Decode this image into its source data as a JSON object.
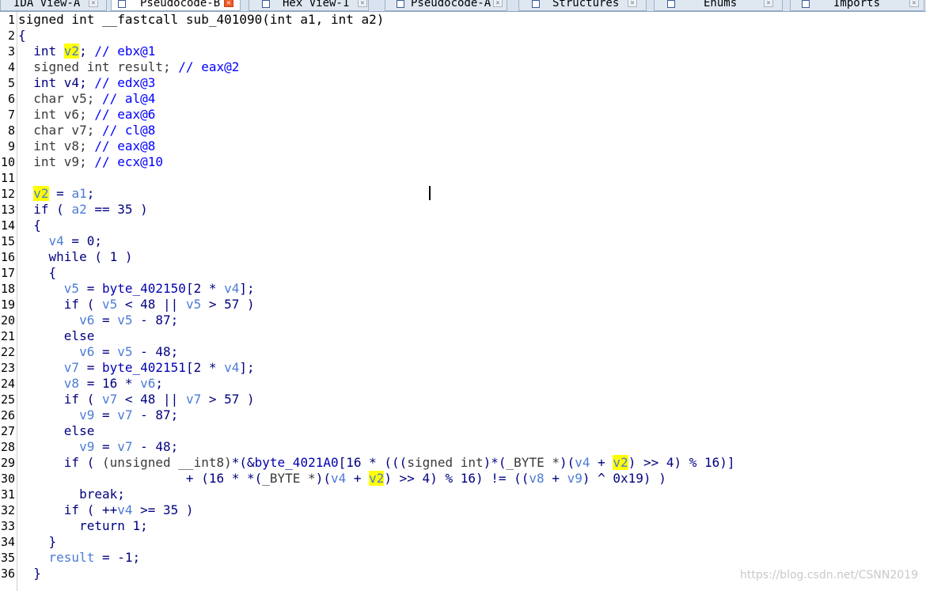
{
  "tabs": [
    {
      "label": "IDA View-A",
      "active": false,
      "icon": "ida-view-icon"
    },
    {
      "label": "Pseudocode-B",
      "active": true,
      "icon": "pseudocode-icon"
    },
    {
      "label": "Hex View-1",
      "active": false,
      "icon": "hex-view-icon"
    },
    {
      "label": "Pseudocode-A",
      "active": false,
      "icon": "pseudocode-icon"
    },
    {
      "label": "Structures",
      "active": false,
      "icon": "structures-icon"
    },
    {
      "label": "Enums",
      "active": false,
      "icon": "enums-icon"
    },
    {
      "label": "Imports",
      "active": false,
      "icon": "imports-icon"
    }
  ],
  "code": {
    "highlight_variable": "v2",
    "lines": [
      {
        "n": "1",
        "tokens": [
          [
            "plain",
            "signed int __fastcall sub_401090(int a1, int a2)"
          ]
        ]
      },
      {
        "n": "2",
        "tokens": [
          [
            "txt",
            "{"
          ]
        ]
      },
      {
        "n": "3",
        "tokens": [
          [
            "txt",
            "  int "
          ],
          [
            "varhl",
            "v2"
          ],
          [
            "txt",
            "; "
          ],
          [
            "cm",
            "// ebx@1"
          ]
        ]
      },
      {
        "n": "4",
        "tokens": [
          [
            "cast",
            "  signed int result; "
          ],
          [
            "cm",
            "// eax@2"
          ]
        ]
      },
      {
        "n": "5",
        "tokens": [
          [
            "txt",
            "  int v4; "
          ],
          [
            "cm",
            "// edx@3"
          ]
        ]
      },
      {
        "n": "6",
        "tokens": [
          [
            "cast",
            "  char v5; "
          ],
          [
            "cm",
            "// al@4"
          ]
        ]
      },
      {
        "n": "7",
        "tokens": [
          [
            "cast",
            "  int v6; "
          ],
          [
            "cm",
            "// eax@6"
          ]
        ]
      },
      {
        "n": "8",
        "tokens": [
          [
            "cast",
            "  char v7; "
          ],
          [
            "cm",
            "// cl@8"
          ]
        ]
      },
      {
        "n": "9",
        "tokens": [
          [
            "cast",
            "  int v8; "
          ],
          [
            "cm",
            "// eax@8"
          ]
        ]
      },
      {
        "n": "10",
        "tokens": [
          [
            "cast",
            "  int v9; "
          ],
          [
            "cm",
            "// ecx@10"
          ]
        ]
      },
      {
        "n": "11",
        "tokens": []
      },
      {
        "n": "12",
        "tokens": [
          [
            "txt",
            "  "
          ],
          [
            "varhl",
            "v2"
          ],
          [
            "txt",
            " = "
          ],
          [
            "var",
            "a1"
          ],
          [
            "txt",
            ";"
          ]
        ]
      },
      {
        "n": "13",
        "tokens": [
          [
            "txt",
            "  if ( "
          ],
          [
            "var",
            "a2"
          ],
          [
            "txt",
            " == 35 )"
          ]
        ]
      },
      {
        "n": "14",
        "tokens": [
          [
            "txt",
            "  {"
          ]
        ]
      },
      {
        "n": "15",
        "tokens": [
          [
            "txt",
            "    "
          ],
          [
            "var",
            "v4"
          ],
          [
            "txt",
            " = 0;"
          ]
        ]
      },
      {
        "n": "16",
        "tokens": [
          [
            "txt",
            "    while ( 1 )"
          ]
        ]
      },
      {
        "n": "17",
        "tokens": [
          [
            "txt",
            "    {"
          ]
        ]
      },
      {
        "n": "18",
        "tokens": [
          [
            "txt",
            "      "
          ],
          [
            "var",
            "v5"
          ],
          [
            "txt",
            " = "
          ],
          [
            "glob",
            "byte_402150"
          ],
          [
            "txt",
            "[2 * "
          ],
          [
            "var",
            "v4"
          ],
          [
            "txt",
            "];"
          ]
        ]
      },
      {
        "n": "19",
        "tokens": [
          [
            "txt",
            "      if ( "
          ],
          [
            "var",
            "v5"
          ],
          [
            "txt",
            " < 48 || "
          ],
          [
            "var",
            "v5"
          ],
          [
            "txt",
            " > 57 )"
          ]
        ]
      },
      {
        "n": "20",
        "tokens": [
          [
            "txt",
            "        "
          ],
          [
            "var",
            "v6"
          ],
          [
            "txt",
            " = "
          ],
          [
            "var",
            "v5"
          ],
          [
            "txt",
            " - 87;"
          ]
        ]
      },
      {
        "n": "21",
        "tokens": [
          [
            "txt",
            "      else"
          ]
        ]
      },
      {
        "n": "22",
        "tokens": [
          [
            "txt",
            "        "
          ],
          [
            "var",
            "v6"
          ],
          [
            "txt",
            " = "
          ],
          [
            "var",
            "v5"
          ],
          [
            "txt",
            " - 48;"
          ]
        ]
      },
      {
        "n": "23",
        "tokens": [
          [
            "txt",
            "      "
          ],
          [
            "var",
            "v7"
          ],
          [
            "txt",
            " = "
          ],
          [
            "glob",
            "byte_402151"
          ],
          [
            "txt",
            "[2 * "
          ],
          [
            "var",
            "v4"
          ],
          [
            "txt",
            "];"
          ]
        ]
      },
      {
        "n": "24",
        "tokens": [
          [
            "txt",
            "      "
          ],
          [
            "var",
            "v8"
          ],
          [
            "txt",
            " = 16 * "
          ],
          [
            "var",
            "v6"
          ],
          [
            "txt",
            ";"
          ]
        ]
      },
      {
        "n": "25",
        "tokens": [
          [
            "txt",
            "      if ( "
          ],
          [
            "var",
            "v7"
          ],
          [
            "txt",
            " < 48 || "
          ],
          [
            "var",
            "v7"
          ],
          [
            "txt",
            " > 57 )"
          ]
        ]
      },
      {
        "n": "26",
        "tokens": [
          [
            "txt",
            "        "
          ],
          [
            "var",
            "v9"
          ],
          [
            "txt",
            " = "
          ],
          [
            "var",
            "v7"
          ],
          [
            "txt",
            " - 87;"
          ]
        ]
      },
      {
        "n": "27",
        "tokens": [
          [
            "txt",
            "      else"
          ]
        ]
      },
      {
        "n": "28",
        "tokens": [
          [
            "txt",
            "        "
          ],
          [
            "var",
            "v9"
          ],
          [
            "txt",
            " = "
          ],
          [
            "var",
            "v7"
          ],
          [
            "txt",
            " - 48;"
          ]
        ]
      },
      {
        "n": "29",
        "tokens": [
          [
            "txt",
            "      if ( "
          ],
          [
            "cast",
            "(unsigned __int8)"
          ],
          [
            "txt",
            "*(&"
          ],
          [
            "glob",
            "byte_4021A0"
          ],
          [
            "txt",
            "[16 * ((("
          ],
          [
            "cast",
            "signed int"
          ],
          [
            "txt",
            ")*("
          ],
          [
            "cast",
            "_BYTE *"
          ],
          [
            "txt",
            ")("
          ],
          [
            "var",
            "v4"
          ],
          [
            "txt",
            " + "
          ],
          [
            "varhl",
            "v2"
          ],
          [
            "txt",
            ") >> 4) % 16)]"
          ]
        ]
      },
      {
        "n": "30",
        "tokens": [
          [
            "txt",
            "                      + (16 * *("
          ],
          [
            "cast",
            "_BYTE *"
          ],
          [
            "txt",
            ")("
          ],
          [
            "var",
            "v4"
          ],
          [
            "txt",
            " + "
          ],
          [
            "varhl",
            "v2"
          ],
          [
            "txt",
            ") >> 4) % 16) != (("
          ],
          [
            "var",
            "v8"
          ],
          [
            "txt",
            " + "
          ],
          [
            "var",
            "v9"
          ],
          [
            "txt",
            ") ^ 0x19) )"
          ]
        ]
      },
      {
        "n": "31",
        "tokens": [
          [
            "txt",
            "        break;"
          ]
        ]
      },
      {
        "n": "32",
        "tokens": [
          [
            "txt",
            "      if ( ++"
          ],
          [
            "var",
            "v4"
          ],
          [
            "txt",
            " >= 35 )"
          ]
        ]
      },
      {
        "n": "33",
        "tokens": [
          [
            "txt",
            "        return 1;"
          ]
        ]
      },
      {
        "n": "34",
        "tokens": [
          [
            "txt",
            "    }"
          ]
        ]
      },
      {
        "n": "35",
        "tokens": [
          [
            "txt",
            "    "
          ],
          [
            "var",
            "result"
          ],
          [
            "txt",
            " = -1;"
          ]
        ]
      },
      {
        "n": "36",
        "tokens": [
          [
            "txt",
            "  }"
          ]
        ]
      }
    ]
  },
  "watermark": "https://blog.csdn.net/CSNN2019"
}
